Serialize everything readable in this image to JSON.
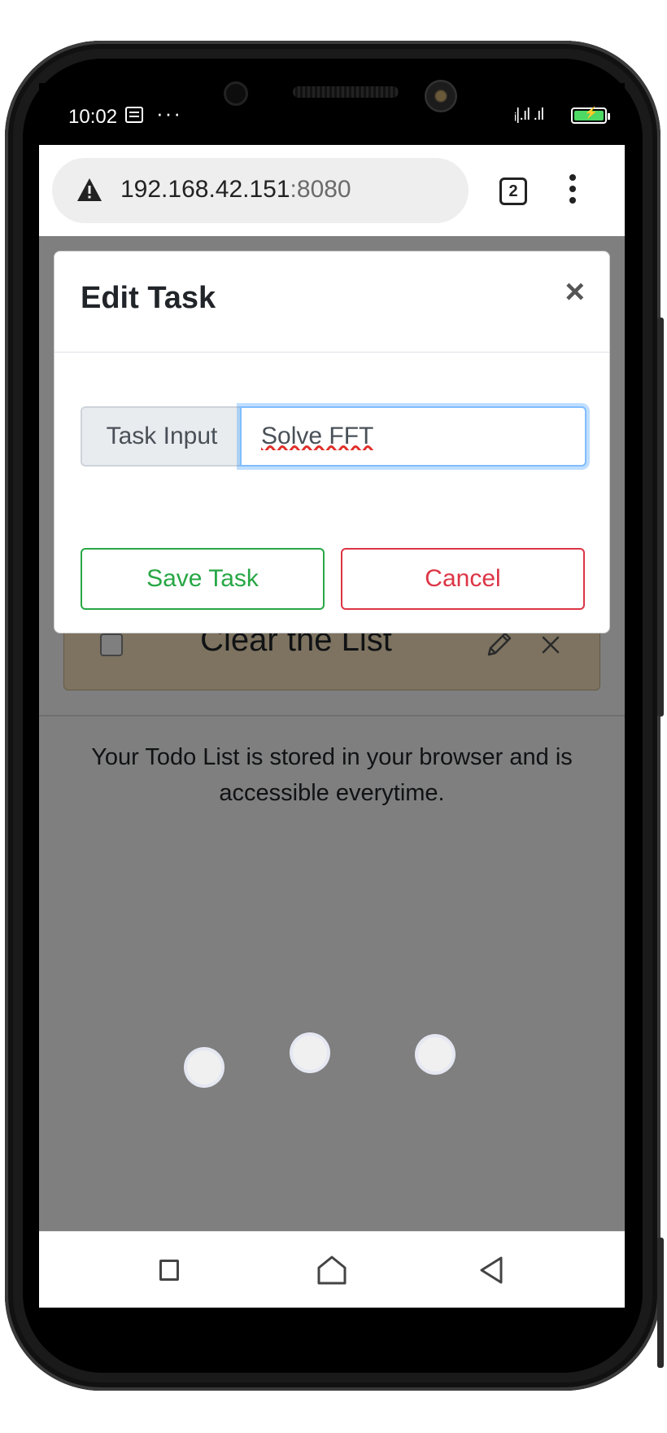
{
  "status_bar": {
    "time": "10:02",
    "more": "···",
    "signal": "ᵢ|.ıl .ıl"
  },
  "browser": {
    "url_host": "192.168.42.151",
    "url_port": ":8080",
    "tab_count": "2"
  },
  "modal": {
    "title": "Edit Task",
    "close": "×",
    "input_label": "Task Input",
    "input_value": "Solve FFT",
    "save_label": "Save Task",
    "cancel_label": "Cancel"
  },
  "list": {
    "item_text": "Clear the List"
  },
  "footer": {
    "text": "Your Todo List is stored in your browser and is accessible everytime."
  },
  "colors": {
    "save": "#28a745",
    "cancel": "#dc3545",
    "input_focus": "#80bdff",
    "item_bg": "#fbe7c0",
    "item_green": "#c8ecd4"
  }
}
